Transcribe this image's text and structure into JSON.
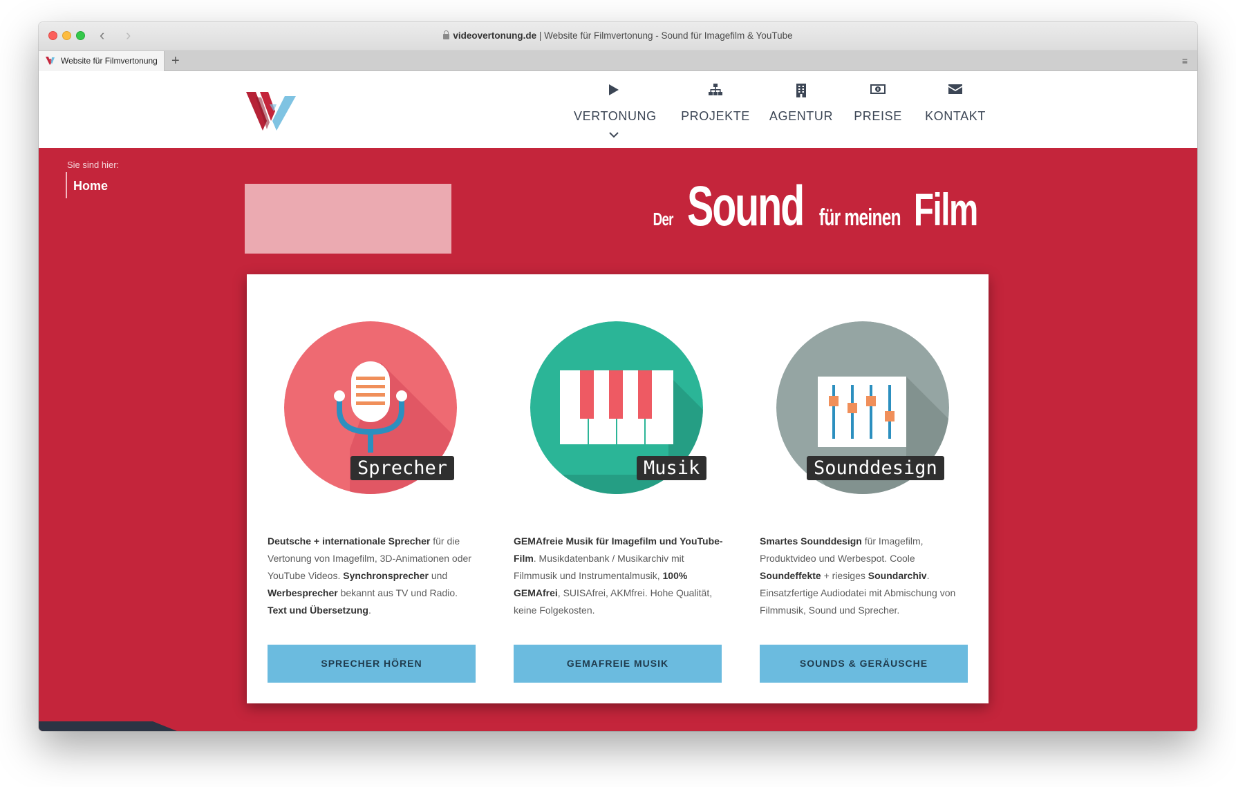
{
  "browser": {
    "url_domain": "videovertonung.de",
    "url_rest": " | Website für Filmvertonung - Sound für Imagefilm & YouTube",
    "tab_title": "Website für Filmvertonung",
    "tab_add": "+",
    "tab_menu": "≡",
    "back": "‹",
    "forward": "›"
  },
  "nav": {
    "items": [
      {
        "label": "VERTONUNG",
        "icon": "play-icon"
      },
      {
        "label": "PROJEKTE",
        "icon": "sitemap-icon"
      },
      {
        "label": "AGENTUR",
        "icon": "building-icon"
      },
      {
        "label": "PREISE",
        "icon": "money-icon"
      },
      {
        "label": "KONTAKT",
        "icon": "envelope-icon"
      }
    ]
  },
  "breadcrumb": {
    "label": "Sie sind hier:",
    "home": "Home"
  },
  "headline": {
    "w1": "Der",
    "w2": "Sound",
    "w3": "für meinen",
    "w4": "Film"
  },
  "features": [
    {
      "badge": "Sprecher",
      "cta": "SPRECHER HÖREN",
      "desc": [
        {
          "t": "Deutsche + internationale Sprecher",
          "b": true
        },
        {
          "t": " für die Vertonung von Imagefilm, 3D-Animationen oder YouTube Videos. ",
          "b": false
        },
        {
          "t": "Synchronsprecher",
          "b": true
        },
        {
          "t": " und ",
          "b": false
        },
        {
          "t": "Werbesprecher",
          "b": true
        },
        {
          "t": " bekannt aus TV und Radio. ",
          "b": false
        },
        {
          "t": "Text und Übersetzung",
          "b": true
        },
        {
          "t": ".",
          "b": false
        }
      ]
    },
    {
      "badge": "Musik",
      "cta": "GEMAFREIE MUSIK",
      "desc": [
        {
          "t": "GEMAfreie Musik für Imagefilm und YouTube-Film",
          "b": true
        },
        {
          "t": ". Musikdatenbank / Musikarchiv mit Filmmusik und Instrumentalmusik, ",
          "b": false
        },
        {
          "t": "100% GEMAfrei",
          "b": true
        },
        {
          "t": ", SUISAfrei, AKMfrei. Hohe Qualität, keine Folgekosten.",
          "b": false
        }
      ]
    },
    {
      "badge": "Sounddesign",
      "cta": "SOUNDS & GERÄUSCHE",
      "desc": [
        {
          "t": "Smartes Sounddesign",
          "b": true
        },
        {
          "t": " für Imagefilm, Produktvideo und Werbespot. Coole ",
          "b": false
        },
        {
          "t": "Soundeffekte",
          "b": true
        },
        {
          "t": " + riesiges ",
          "b": false
        },
        {
          "t": "Soundarchiv",
          "b": true
        },
        {
          "t": ". Einsatzfertige Audiodatei mit Abmischung von Filmmusik, Sound und Sprecher.",
          "b": false
        }
      ]
    }
  ],
  "colors": {
    "hero": "#c4253b",
    "button": "#6bbbdf",
    "sprecher": "#ee6a72",
    "musik": "#2bb597",
    "sounddesign": "#95a5a3"
  }
}
